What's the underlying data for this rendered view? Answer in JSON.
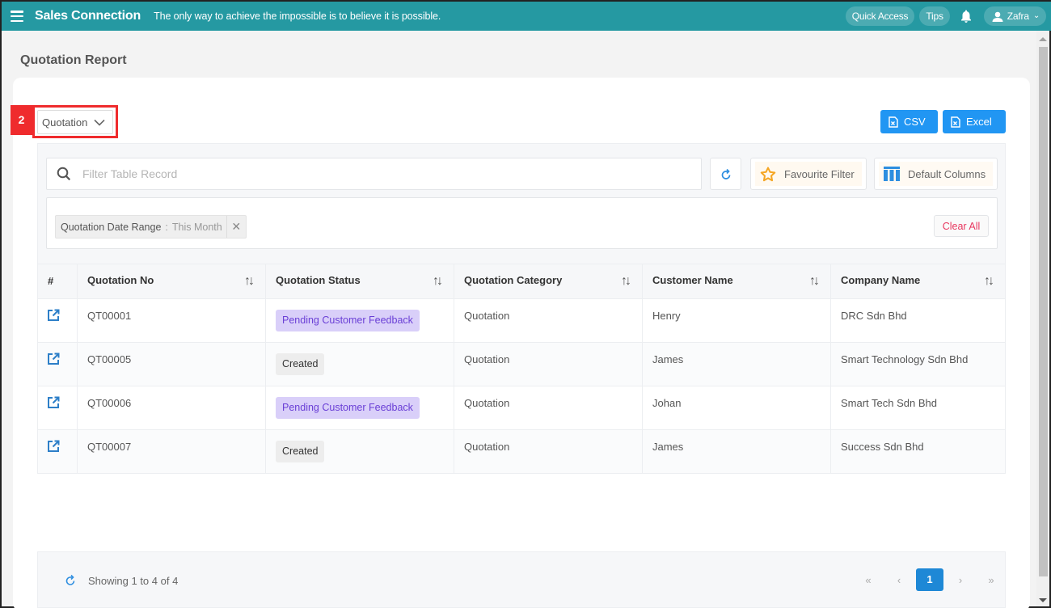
{
  "app": {
    "title": "Sales Connection",
    "tagline": "The only way to achieve the impossible is to believe it is possible.",
    "brand_color": "#2599a2"
  },
  "topbar": {
    "quick_access_label": "Quick Access",
    "tips_label": "Tips",
    "user_name": "Zafra",
    "icons": {
      "menu": "hamburger-icon",
      "bell": "bell-icon",
      "user": "user-icon",
      "caret": "chevron-down-icon"
    }
  },
  "page": {
    "title": "Quotation Report"
  },
  "annotation": {
    "marker_number": "2",
    "color": "#ef2b2d"
  },
  "report_type_select": {
    "selected": "Quotation"
  },
  "export": {
    "csv_label": "CSV",
    "excel_label": "Excel",
    "button_color": "#2196f3"
  },
  "filter": {
    "search_placeholder": "Filter Table Record",
    "search_value": "",
    "favourite_label": "Favourite Filter",
    "columns_label": "Default Columns",
    "chips": [
      {
        "label": "Quotation Date Range",
        "separator": ":",
        "value": "This Month"
      }
    ],
    "clear_all_label": "Clear All"
  },
  "table": {
    "columns": [
      {
        "label": "#"
      },
      {
        "label": "Quotation No",
        "sortable": true
      },
      {
        "label": "Quotation Status",
        "sortable": true
      },
      {
        "label": "Quotation Category",
        "sortable": true
      },
      {
        "label": "Customer Name",
        "sortable": true
      },
      {
        "label": "Company Name",
        "sortable": true
      }
    ],
    "sort_glyph": "↑↓",
    "rows": [
      {
        "quotation_no": "QT00001",
        "status": "Pending Customer Feedback",
        "status_type": "pending",
        "category": "Quotation",
        "customer": "Henry",
        "company": "DRC Sdn Bhd"
      },
      {
        "quotation_no": "QT00005",
        "status": "Created",
        "status_type": "created",
        "category": "Quotation",
        "customer": "James",
        "company": "Smart Technology Sdn Bhd"
      },
      {
        "quotation_no": "QT00006",
        "status": "Pending Customer Feedback",
        "status_type": "pending",
        "category": "Quotation",
        "customer": "Johan",
        "company": "Smart Tech Sdn Bhd"
      },
      {
        "quotation_no": "QT00007",
        "status": "Created",
        "status_type": "created",
        "category": "Quotation",
        "customer": "James",
        "company": "Success Sdn Bhd"
      }
    ]
  },
  "footer": {
    "showing_text": "Showing 1 to 4 of 4",
    "pagination": {
      "first": "«",
      "prev": "‹",
      "current_page": "1",
      "next": "›",
      "last": "»"
    }
  }
}
